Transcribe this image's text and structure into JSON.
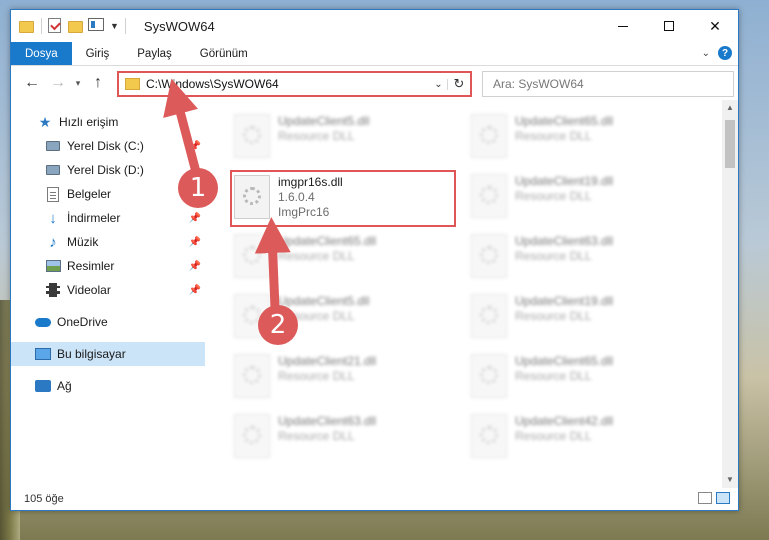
{
  "window": {
    "title": "SysWOW64",
    "controls": {
      "minimize": "—",
      "maximize": "☐",
      "close": "✕"
    }
  },
  "ribbon": {
    "tabs": [
      {
        "label": "Dosya",
        "active": true
      },
      {
        "label": "Giriş"
      },
      {
        "label": "Paylaş"
      },
      {
        "label": "Görünüm"
      }
    ],
    "help": "?"
  },
  "address": {
    "path": "C:\\Windows\\SysWOW64",
    "search_placeholder": "Ara: SysWOW64"
  },
  "nav": {
    "items": [
      {
        "label": "Hızlı erişim",
        "icon": "star-icon"
      },
      {
        "label": "Yerel Disk (C:)",
        "icon": "disk-icon",
        "pinned": true
      },
      {
        "label": "Yerel Disk (D:)",
        "icon": "disk-icon"
      },
      {
        "label": "Belgeler",
        "icon": "documents-icon",
        "pinned": true
      },
      {
        "label": "İndirmeler",
        "icon": "downloads-icon",
        "pinned": true
      },
      {
        "label": "Müzik",
        "icon": "music-icon",
        "pinned": true
      },
      {
        "label": "Resimler",
        "icon": "pictures-icon",
        "pinned": true
      },
      {
        "label": "Videolar",
        "icon": "videos-icon",
        "pinned": true
      },
      {
        "label": "OneDrive",
        "icon": "onedrive-icon"
      },
      {
        "label": "Bu bilgisayar",
        "icon": "pc-icon",
        "selected": true
      },
      {
        "label": "Ağ",
        "icon": "network-icon"
      }
    ]
  },
  "files": {
    "highlighted": {
      "name": "imgpr16s.dll",
      "version": "1.6.0.4",
      "description": "ImgPrc16"
    },
    "blurred_left": [
      {
        "name": "UpdateClient5.dll",
        "description": "Resource DLL"
      },
      {
        "name": "UpdateClient65.dll",
        "description": "Resource DLL"
      },
      {
        "name": "UpdateClient5.dll",
        "description": "Resource DLL"
      },
      {
        "name": "UpdateClient21.dll",
        "description": "Resource DLL"
      },
      {
        "name": "UpdateClient63.dll",
        "description": "Resource DLL"
      }
    ],
    "blurred_right": [
      {
        "name": "UpdateClient65.dll",
        "description": "Resource DLL"
      },
      {
        "name": "UpdateClient19.dll",
        "description": "Resource DLL"
      },
      {
        "name": "UpdateClient63.dll",
        "description": "Resource DLL"
      },
      {
        "name": "UpdateClient19.dll",
        "description": "Resource DLL"
      },
      {
        "name": "UpdateClient65.dll",
        "description": "Resource DLL"
      },
      {
        "name": "UpdateClient42.dll",
        "description": "Resource DLL"
      }
    ]
  },
  "status": {
    "count": "105 öğe"
  },
  "annotations": {
    "step1": "1",
    "step2": "2",
    "accent": "#dd5a5a"
  }
}
